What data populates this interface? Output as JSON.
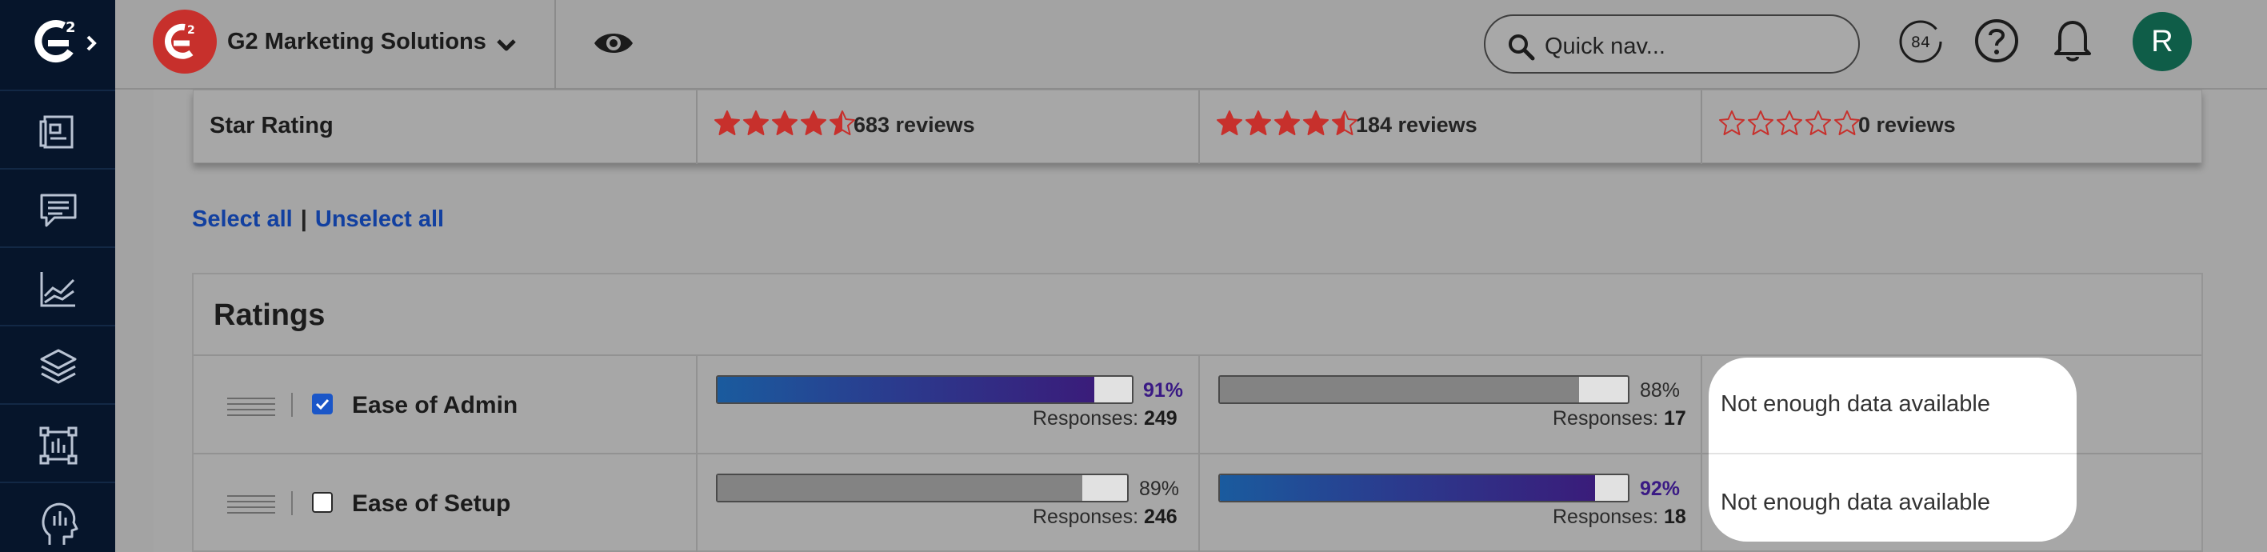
{
  "sidebar": {
    "items": [
      "logo",
      "listings-icon",
      "reviews-icon",
      "analytics-icon",
      "layers-icon",
      "canvas-icon",
      "head-icon"
    ]
  },
  "header": {
    "org_name": "G2 Marketing Solutions",
    "search_placeholder": "Quick nav...",
    "score": "84",
    "avatar_initial": "R",
    "colors": {
      "brand_red": "#c7302c",
      "avatar_green": "#0f5d48",
      "sidebar_navy": "#06152b"
    }
  },
  "star_rating_row": {
    "label": "Star Rating",
    "products": [
      {
        "rating": 4.5,
        "reviews": "683 reviews"
      },
      {
        "rating": 4.5,
        "reviews": "184 reviews"
      },
      {
        "rating": 0,
        "reviews": "0 reviews"
      }
    ]
  },
  "selection": {
    "select_all": "Select all",
    "separator": "|",
    "unselect_all": "Unselect all"
  },
  "ratings": {
    "title": "Ratings",
    "responses_label": "Responses:",
    "rows": [
      {
        "label": "Ease of Admin",
        "checked": true,
        "products": [
          {
            "pct": "91%",
            "value": 0.91,
            "responses": "249",
            "leader": true
          },
          {
            "pct": "88%",
            "value": 0.88,
            "responses": "17",
            "leader": false
          },
          {
            "no_data": "Not enough data available"
          }
        ]
      },
      {
        "label": "Ease of Setup",
        "checked": false,
        "products": [
          {
            "pct": "89%",
            "value": 0.89,
            "responses": "246",
            "leader": false
          },
          {
            "pct": "92%",
            "value": 0.92,
            "responses": "18",
            "leader": true
          },
          {
            "no_data": "Not enough data available"
          }
        ]
      }
    ]
  }
}
